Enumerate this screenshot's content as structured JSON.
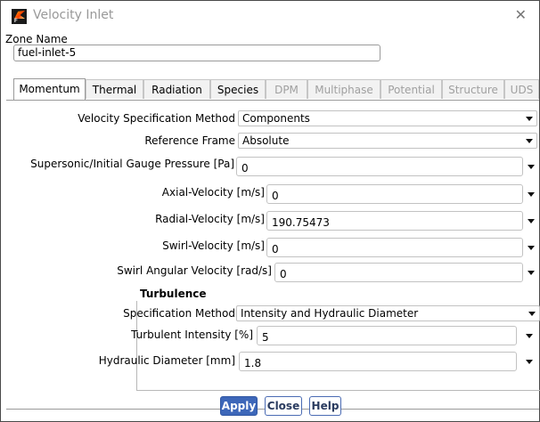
{
  "window": {
    "title": "Velocity Inlet",
    "close_glyph": "✕"
  },
  "app_icon": {
    "name": "fluent-icon",
    "letter": "F"
  },
  "zone": {
    "label": "Zone Name",
    "value": "fuel-inlet-5"
  },
  "tabs": [
    {
      "label": "Momentum",
      "state": "active"
    },
    {
      "label": "Thermal",
      "state": "enabled"
    },
    {
      "label": "Radiation",
      "state": "enabled"
    },
    {
      "label": "Species",
      "state": "enabled"
    },
    {
      "label": "DPM",
      "state": "disabled"
    },
    {
      "label": "Multiphase",
      "state": "disabled"
    },
    {
      "label": "Potential",
      "state": "disabled"
    },
    {
      "label": "Structure",
      "state": "disabled"
    },
    {
      "label": "UDS",
      "state": "disabled"
    }
  ],
  "momentum": {
    "velocity_spec": {
      "label": "Velocity Specification Method",
      "value": "Components"
    },
    "reference_frame": {
      "label": "Reference Frame",
      "value": "Absolute"
    },
    "supersonic_pressure": {
      "label": "Supersonic/Initial Gauge Pressure [Pa]",
      "value": "0"
    },
    "axial_velocity": {
      "label": "Axial-Velocity [m/s]",
      "value": "0"
    },
    "radial_velocity": {
      "label": "Radial-Velocity [m/s]",
      "value": "190.75473"
    },
    "swirl_velocity": {
      "label": "Swirl-Velocity [m/s]",
      "value": "0"
    },
    "swirl_angular_velocity": {
      "label": "Swirl Angular Velocity [rad/s]",
      "value": "0"
    }
  },
  "turbulence": {
    "title": "Turbulence",
    "spec_method": {
      "label": "Specification Method",
      "value": "Intensity and Hydraulic Diameter"
    },
    "intensity": {
      "label": "Turbulent Intensity [%]",
      "value": "5"
    },
    "hydraulic_diameter": {
      "label": "Hydraulic Diameter [mm]",
      "value": "1.8"
    }
  },
  "buttons": {
    "apply": "Apply",
    "close": "Close",
    "help": "Help"
  }
}
